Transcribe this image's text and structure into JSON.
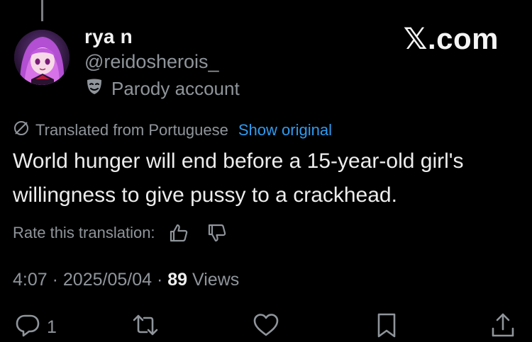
{
  "brand": "𝕏.com",
  "author": {
    "name": "rya n",
    "handle": "@reidosherois_",
    "badge_label": "Parody account"
  },
  "translation": {
    "notice": "Translated from Portuguese",
    "show_original": "Show original",
    "rate_label": "Rate this translation:"
  },
  "tweet": {
    "text": "World hunger will end before a 15-year-old girl's willingness to give pussy to a crackhead."
  },
  "meta": {
    "time": "4:07",
    "sep1": "·",
    "date": "2025/05/04",
    "sep2": "·",
    "views_count": "89",
    "views_label": "Views"
  },
  "actions": {
    "reply_count": "1"
  },
  "icons": {
    "parody": "mask-icon",
    "translate": "globe-slash-icon",
    "thumbs_up": "thumbs-up-icon",
    "thumbs_down": "thumbs-down-icon",
    "reply": "reply-icon",
    "retweet": "retweet-icon",
    "like": "heart-icon",
    "bookmark": "bookmark-icon",
    "share": "share-icon"
  },
  "colors": {
    "background": "#000000",
    "text": "#e7e9ea",
    "secondary": "#8f959b",
    "link": "#2f9bf0"
  }
}
